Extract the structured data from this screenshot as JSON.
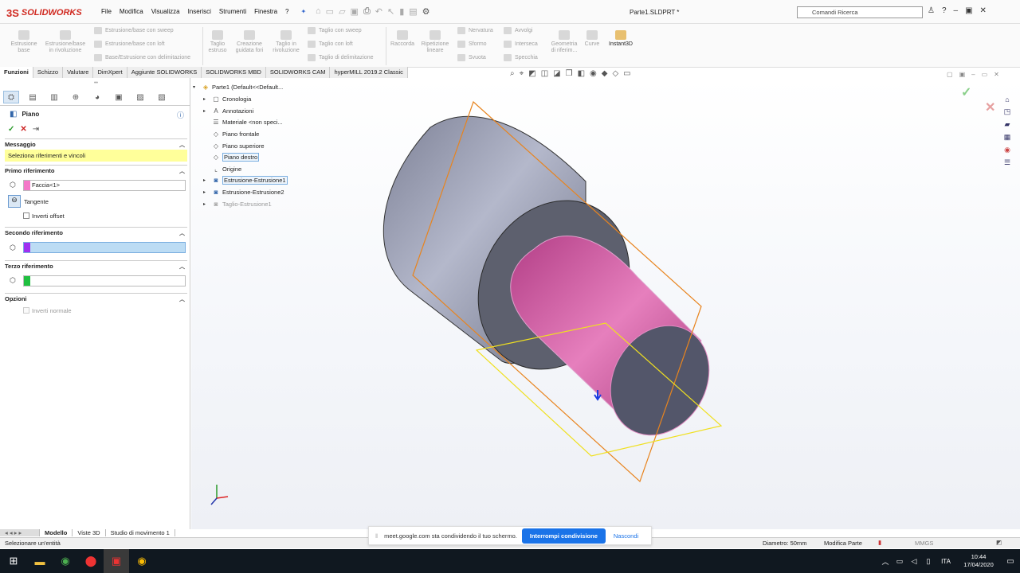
{
  "app": {
    "name": "SOLIDWORKS",
    "doc_title": "Parte1.SLDPRT *"
  },
  "menu": [
    "File",
    "Modifica",
    "Visualizza",
    "Inserisci",
    "Strumenti",
    "Finestra",
    "?"
  ],
  "search": {
    "placeholder": "Comandi Ricerca"
  },
  "ribbon": {
    "big": [
      "Estrusione base",
      "Estrusione/base in rivoluzione",
      "Taglio estruso",
      "Creazione guidata fori",
      "Taglio in rivoluzione",
      "Raccorda",
      "Ripetizione lineare",
      "Geometria di riferim...",
      "Curve",
      "Instant3D"
    ],
    "small1": [
      "Estrusione/base con sweep",
      "Estrusione/base con loft",
      "Base/Estrusione con delimitazione"
    ],
    "small2": [
      "Taglio con sweep",
      "Taglio con loft",
      "Taglio di delimitazione"
    ],
    "small3": [
      "Nervatura",
      "Sformo",
      "Svuota"
    ],
    "small4": [
      "Avvolgi",
      "Interseca",
      "Specchia"
    ]
  },
  "tabs": [
    "Funzioni",
    "Schizzo",
    "Valutare",
    "DimXpert",
    "Aggiunte SOLIDWORKS",
    "SOLIDWORKS MBD",
    "SOLIDWORKS CAM",
    "hyperMILL 2019.2 Classic"
  ],
  "pm": {
    "title": "Piano",
    "msg_head": "Messaggio",
    "msg": "Seleziona riferimenti e vincoli",
    "first": "Primo riferimento",
    "first_value": "Faccia<1>",
    "tangent": "Tangente",
    "invert_offset": "Inverti offset",
    "second": "Secondo riferimento",
    "third": "Terzo riferimento",
    "options": "Opzioni",
    "invert_normal": "Inverti normale",
    "colors": {
      "first": "#f478c8",
      "second": "#a030f0",
      "third": "#20c040"
    }
  },
  "tree": {
    "root": "Parte1  (Default<<Default...",
    "items": [
      "Cronologia",
      "Annotazioni",
      "Materiale <non speci...",
      "Piano frontale",
      "Piano superiore",
      "Piano destro",
      "Origine",
      "Estrusione-Estrusione1",
      "Estrusione-Estrusione2",
      "Taglio-Estrusione1"
    ]
  },
  "bottom_tabs": [
    "Modello",
    "Viste 3D",
    "Studio di movimento 1"
  ],
  "status": {
    "left": "Selezionare un'entità",
    "diam": "Diametro: 50mm",
    "mode": "Modifica Parte",
    "units": "MMGS"
  },
  "share": {
    "text": "meet.google.com sta condividendo il tuo schermo.",
    "stop": "Interrompi condivisione",
    "hide": "Nascondi"
  },
  "taskbar": {
    "lang": "ITA",
    "time": "10:44",
    "date": "17/04/2020"
  }
}
